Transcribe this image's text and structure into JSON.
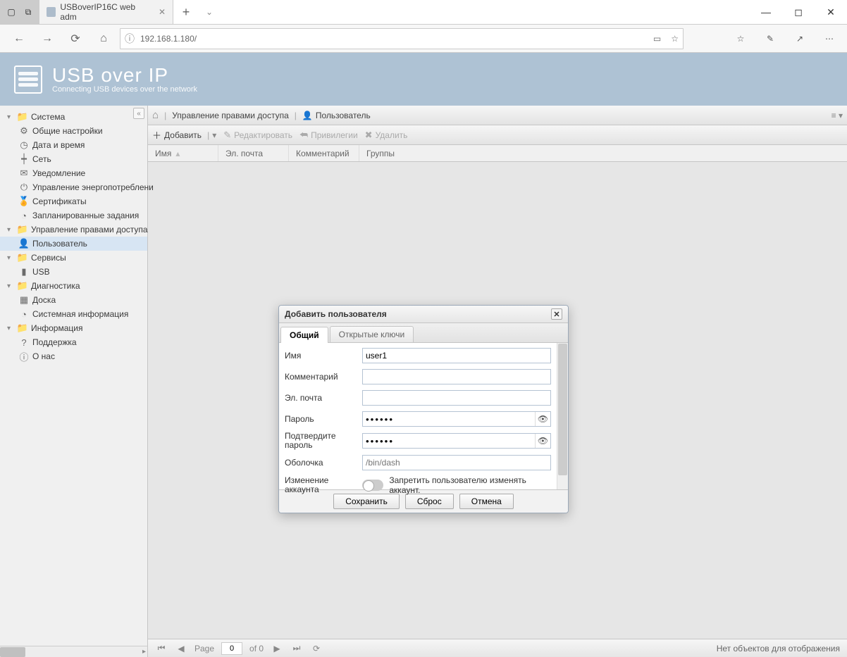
{
  "browser": {
    "tab_title": "USBoverIP16C web adm",
    "url": "192.168.1.180/"
  },
  "banner": {
    "title": "USB over IP",
    "subtitle": "Connecting USB devices over the network"
  },
  "sidebar": {
    "groups": [
      {
        "label": "Система",
        "items": [
          {
            "label": "Общие настройки"
          },
          {
            "label": "Дата и время"
          },
          {
            "label": "Сеть"
          },
          {
            "label": "Уведомление"
          },
          {
            "label": "Управление энергопотреблени"
          },
          {
            "label": "Сертификаты"
          },
          {
            "label": "Запланированные задания"
          }
        ]
      },
      {
        "label": "Управление правами доступа",
        "items": [
          {
            "label": "Пользователь"
          }
        ]
      },
      {
        "label": "Сервисы",
        "items": [
          {
            "label": "USB"
          }
        ]
      },
      {
        "label": "Диагностика",
        "items": [
          {
            "label": "Доска"
          },
          {
            "label": "Системная информация"
          }
        ]
      },
      {
        "label": "Информация",
        "items": [
          {
            "label": "Поддержка"
          },
          {
            "label": "О нас"
          }
        ]
      }
    ]
  },
  "breadcrumb": {
    "items": [
      "Управление правами доступа",
      "Пользователь"
    ]
  },
  "toolbar": {
    "add": "Добавить",
    "edit": "Редактировать",
    "priv": "Привилегии",
    "del": "Удалить"
  },
  "columns": {
    "name": "Имя",
    "email": "Эл. почта",
    "comment": "Комментарий",
    "groups": "Группы"
  },
  "pager": {
    "page_label": "Page",
    "page_value": "0",
    "of_label": "of 0",
    "empty": "Нет объектов для отображения"
  },
  "modal": {
    "title": "Добавить пользователя",
    "tabs": {
      "general": "Общий",
      "keys": "Открытые ключи"
    },
    "fields": {
      "name_label": "Имя",
      "name_value": "user1",
      "comment_label": "Комментарий",
      "comment_value": "",
      "email_label": "Эл. почта",
      "email_value": "",
      "pw_label": "Пароль",
      "pw_value": "••••••",
      "pw2_label": "Подтвердите пароль",
      "pw2_value": "••••••",
      "shell_label": "Оболочка",
      "shell_placeholder": "/bin/dash",
      "acct_label": "Изменение аккаунта",
      "acct_hint": "Запретить пользователю изменять аккаунт."
    },
    "buttons": {
      "save": "Сохранить",
      "reset": "Сброс",
      "cancel": "Отмена"
    }
  }
}
